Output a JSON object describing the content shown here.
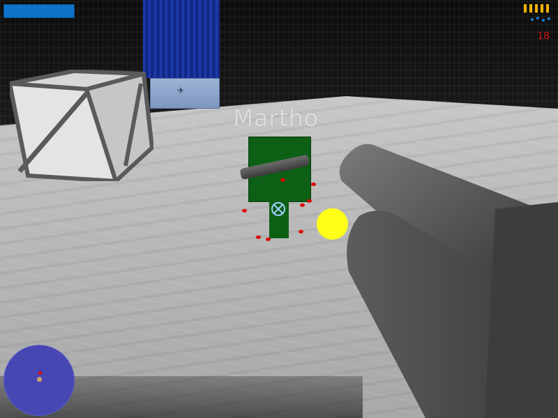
{
  "enemy": {
    "name": "Martho"
  },
  "hud": {
    "health": {
      "fraction": 1.0,
      "color": "#0d74c9"
    },
    "ammo": {
      "count": "18",
      "rounds_icons": 5,
      "icon": "bullet-icon"
    },
    "radar": {
      "color": "#4747b4",
      "enemies_shown": 1
    }
  },
  "colors": {
    "enemy": "#0d5f15",
    "muzzle_flash": "#ffff1a",
    "blood": "#e00000",
    "ammo_text": "#d01010"
  }
}
